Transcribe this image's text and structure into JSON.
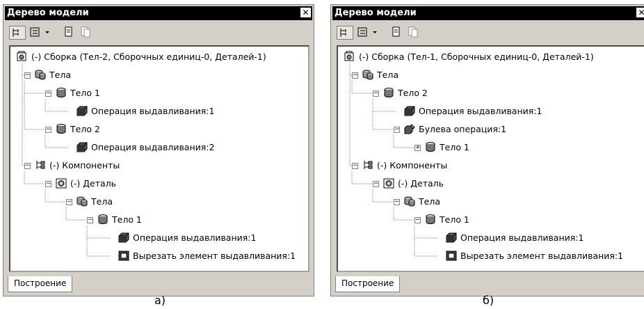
{
  "panels": [
    {
      "title": "Дерево модели",
      "close": "✕",
      "tab": "Построение",
      "caption": "а)",
      "nodes": [
        {
          "text": "(-) Сборка (Тел-2, Сборочных единиц-0, Деталей-1)",
          "icon": "assembly-icon",
          "level": 0,
          "pm": ""
        },
        {
          "text": "Тела",
          "icon": "bodies-icon",
          "level": 1,
          "pm": "−"
        },
        {
          "text": "Тело 1",
          "icon": "body-icon",
          "level": 2,
          "pm": "−"
        },
        {
          "text": "Операция выдавливания:1",
          "icon": "extrude-icon",
          "level": 3,
          "pm": ""
        },
        {
          "text": "Тело 2",
          "icon": "body-icon",
          "level": 2,
          "pm": "−"
        },
        {
          "text": "Операция выдавливания:2",
          "icon": "extrude-icon",
          "level": 3,
          "pm": ""
        },
        {
          "text": "(-) Компоненты",
          "icon": "components-icon",
          "level": 1,
          "pm": "−"
        },
        {
          "text": "(-) Деталь",
          "icon": "part-icon",
          "level": 2,
          "pm": "−"
        },
        {
          "text": "Тела",
          "icon": "bodies-icon",
          "level": 3,
          "pm": "−"
        },
        {
          "text": "Тело 1",
          "icon": "body-icon",
          "level": 4,
          "pm": "−"
        },
        {
          "text": "Операция выдавливания:1",
          "icon": "extrude-icon",
          "level": 5,
          "pm": ""
        },
        {
          "text": "Вырезать элемент выдавливания:1",
          "icon": "cut-extrude-icon",
          "level": 5,
          "pm": ""
        }
      ]
    },
    {
      "title": "Дерево модели",
      "close": "✕",
      "tab": "Построение",
      "caption": "б)",
      "nodes": [
        {
          "text": "(-) Сборка (Тел-1, Сборочных единиц-0, Деталей-1)",
          "icon": "assembly-icon",
          "level": 0,
          "pm": ""
        },
        {
          "text": "Тела",
          "icon": "bodies-icon",
          "level": 1,
          "pm": "−"
        },
        {
          "text": "Тело 2",
          "icon": "body-icon",
          "level": 2,
          "pm": "−"
        },
        {
          "text": "Операция выдавливания:1",
          "icon": "extrude-icon",
          "level": 3,
          "pm": ""
        },
        {
          "text": "Булева операция:1",
          "icon": "boolean-icon",
          "level": 3,
          "pm": "−"
        },
        {
          "text": "Тело 1",
          "icon": "body-icon",
          "level": 4,
          "pm": "+"
        },
        {
          "text": "(-) Компоненты",
          "icon": "components-icon",
          "level": 1,
          "pm": "−"
        },
        {
          "text": "(-) Деталь",
          "icon": "part-icon",
          "level": 2,
          "pm": "−"
        },
        {
          "text": "Тела",
          "icon": "bodies-icon",
          "level": 3,
          "pm": "−"
        },
        {
          "text": "Тело 1",
          "icon": "body-icon",
          "level": 4,
          "pm": "−"
        },
        {
          "text": "Операция выдавливания:1",
          "icon": "extrude-icon",
          "level": 5,
          "pm": ""
        },
        {
          "text": "Вырезать элемент выдавливания:1",
          "icon": "cut-extrude-icon",
          "level": 5,
          "pm": ""
        }
      ]
    }
  ]
}
